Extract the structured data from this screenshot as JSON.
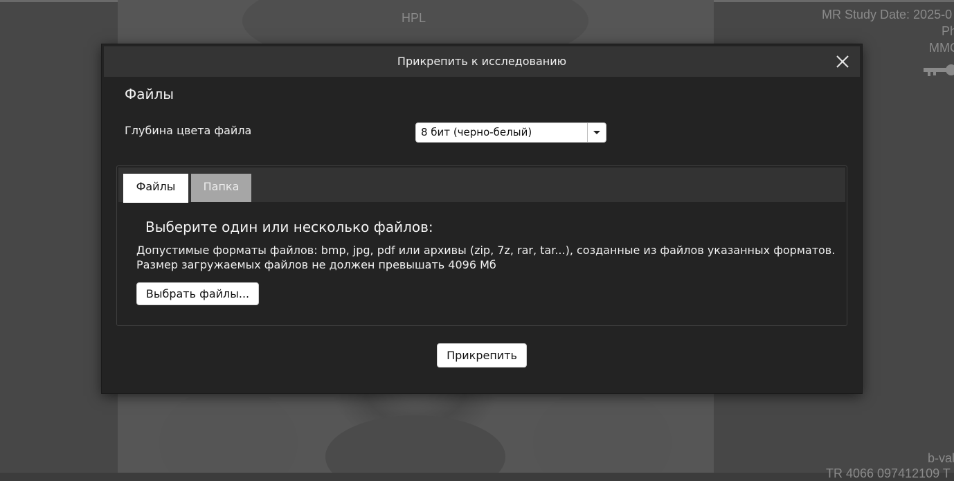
{
  "viewer": {
    "overlay_top_center": "HPL",
    "overlay_top_right_1": "MR Study Date: 2025-0",
    "overlay_top_right_2": "Ph",
    "overlay_top_right_3": "MMC",
    "overlay_bottom_right_1": "b-val",
    "overlay_bottom_right_2": "TR 4066 097412109 T"
  },
  "modal": {
    "title": "Прикрепить к исследованию",
    "section_title": "Файлы",
    "color_depth": {
      "label": "Глубина цвета файла",
      "selected": "8 бит (черно-белый)"
    },
    "tabs": [
      {
        "label": "Файлы",
        "active": true
      },
      {
        "label": "Папка",
        "active": false
      }
    ],
    "files_tab": {
      "heading": "Выберите один или несколько файлов:",
      "formats_text": "Допустимые форматы файлов: bmp, jpg, pdf или архивы (zip, 7z, rar, tar...), созданные из файлов указанных форматов.",
      "size_text": "Размер загружаемых файлов не должен превышать 4096 Мб",
      "choose_button": "Выбрать файлы..."
    },
    "attach_button": "Прикрепить",
    "icons": {
      "close": "close-icon",
      "dropdown": "chevron-down-icon"
    }
  }
}
